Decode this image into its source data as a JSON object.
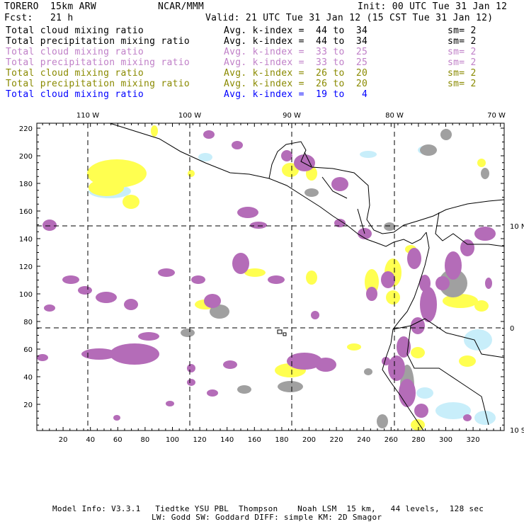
{
  "header": {
    "model": "TORERO  15km ARW",
    "org": "NCAR/MMM",
    "init": "Init: 00 UTC Tue 31 Jan 12",
    "fcst": "Fcst:   21 h",
    "valid": "Valid: 21 UTC Tue 31 Jan 12 (15 CST Tue 31 Jan 12)"
  },
  "legend": [
    {
      "field": "Total cloud mixing ratio",
      "range": "Avg. k-index =  44 to  34",
      "sm": "sm= 2",
      "color": "#000000"
    },
    {
      "field": "Total precipitation mixing ratio",
      "range": "Avg. k-index =  44 to  34",
      "sm": "sm= 2",
      "color": "#000000"
    },
    {
      "field": "Total cloud mixing ratio",
      "range": "Avg. k-index =  33 to  25",
      "sm": "sm= 2",
      "color": "#c080c8"
    },
    {
      "field": "Total precipitation mixing ratio",
      "range": "Avg. k-index =  33 to  25",
      "sm": "sm= 2",
      "color": "#c080c8"
    },
    {
      "field": "Total cloud mixing ratio",
      "range": "Avg. k-index =  26 to  20",
      "sm": "sm= 2",
      "color": "#8a8a00"
    },
    {
      "field": "Total precipitation mixing ratio",
      "range": "Avg. k-index =  26 to  20",
      "sm": "sm= 2",
      "color": "#8a8a00"
    },
    {
      "field": "Total cloud mixing ratio",
      "range": "Avg. k-index =  19 to   4",
      "sm": "",
      "color": "#0000ff"
    }
  ],
  "map": {
    "x_ticks": [
      "20",
      "40",
      "60",
      "80",
      "100",
      "120",
      "140",
      "160",
      "180",
      "200",
      "220",
      "240",
      "260",
      "280",
      "300",
      "320"
    ],
    "y_ticks": [
      "20",
      "40",
      "60",
      "80",
      "100",
      "120",
      "140",
      "160",
      "180",
      "200",
      "220"
    ],
    "lon_labels": [
      "110 W",
      "100 W",
      "90 W",
      "80 W",
      "70 W"
    ],
    "lat_labels": [
      "10 N",
      "0",
      "10 S"
    ],
    "colors": {
      "high": "#a0a0a0",
      "mid": "#b46cb8",
      "low": "#ffff50",
      "lowest": "#c8eefa"
    }
  },
  "footer": {
    "line1": "Model Info: V3.3.1   Tiedtke YSU PBL  Thompson    Noah LSM  15 km,   44 levels,  128 sec",
    "line2": "LW: Godd SW: Goddard DIFF: simple KM: 2D Smagor"
  }
}
